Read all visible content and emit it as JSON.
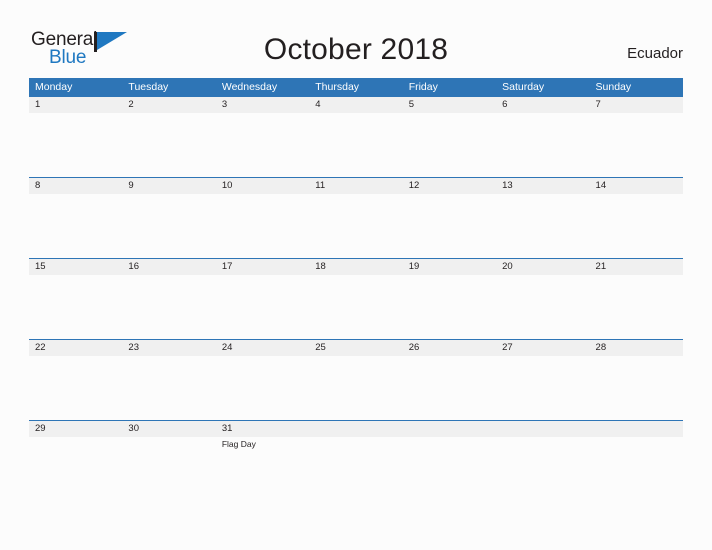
{
  "brand": {
    "name_line1": "General",
    "name_line2": "Blue",
    "primary_color": "#1f78c1",
    "text_color": "#231f20",
    "flag_icon": "flag-triangle-icon"
  },
  "header": {
    "title": "October 2018",
    "country": "Ecuador"
  },
  "calendar": {
    "header_bg": "#2e75b6",
    "number_band_bg": "#f0f0f0",
    "separator_color": "#2e75b6",
    "weekdays": [
      "Monday",
      "Tuesday",
      "Wednesday",
      "Thursday",
      "Friday",
      "Saturday",
      "Sunday"
    ],
    "weeks": [
      {
        "days": [
          {
            "number": "1",
            "events": []
          },
          {
            "number": "2",
            "events": []
          },
          {
            "number": "3",
            "events": []
          },
          {
            "number": "4",
            "events": []
          },
          {
            "number": "5",
            "events": []
          },
          {
            "number": "6",
            "events": []
          },
          {
            "number": "7",
            "events": []
          }
        ]
      },
      {
        "days": [
          {
            "number": "8",
            "events": []
          },
          {
            "number": "9",
            "events": []
          },
          {
            "number": "10",
            "events": []
          },
          {
            "number": "11",
            "events": []
          },
          {
            "number": "12",
            "events": []
          },
          {
            "number": "13",
            "events": []
          },
          {
            "number": "14",
            "events": []
          }
        ]
      },
      {
        "days": [
          {
            "number": "15",
            "events": []
          },
          {
            "number": "16",
            "events": []
          },
          {
            "number": "17",
            "events": []
          },
          {
            "number": "18",
            "events": []
          },
          {
            "number": "19",
            "events": []
          },
          {
            "number": "20",
            "events": []
          },
          {
            "number": "21",
            "events": []
          }
        ]
      },
      {
        "days": [
          {
            "number": "22",
            "events": []
          },
          {
            "number": "23",
            "events": []
          },
          {
            "number": "24",
            "events": []
          },
          {
            "number": "25",
            "events": []
          },
          {
            "number": "26",
            "events": []
          },
          {
            "number": "27",
            "events": []
          },
          {
            "number": "28",
            "events": []
          }
        ]
      },
      {
        "days": [
          {
            "number": "29",
            "events": []
          },
          {
            "number": "30",
            "events": []
          },
          {
            "number": "31",
            "events": [
              "Flag Day"
            ]
          },
          {
            "number": "",
            "events": []
          },
          {
            "number": "",
            "events": []
          },
          {
            "number": "",
            "events": []
          },
          {
            "number": "",
            "events": []
          }
        ]
      }
    ]
  }
}
